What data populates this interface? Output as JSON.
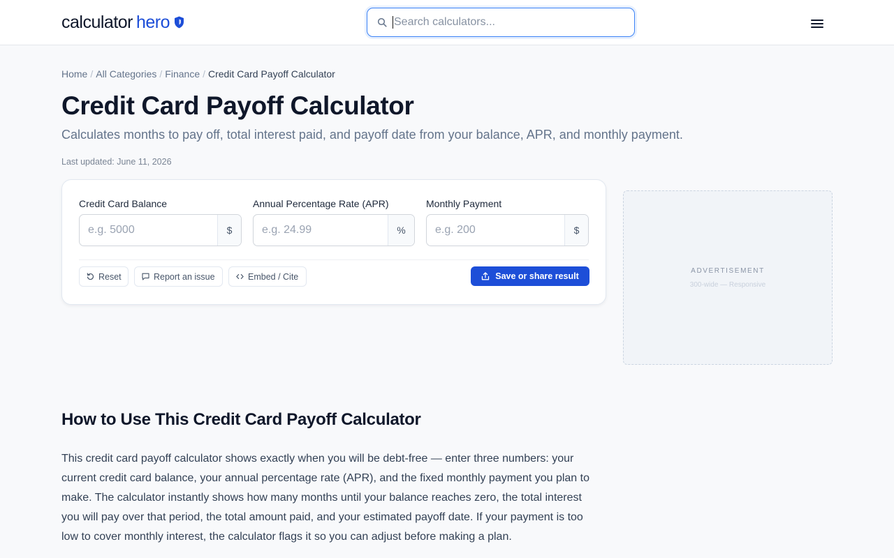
{
  "header": {
    "logo_part1": "calculator",
    "logo_part2": "hero",
    "search_placeholder": "Search calculators...",
    "accent_color": "#1d4ed8"
  },
  "breadcrumb": {
    "items": [
      "Home",
      "All Categories",
      "Finance"
    ],
    "current": "Credit Card Payoff Calculator",
    "separator": "/"
  },
  "page": {
    "title": "Credit Card Payoff Calculator",
    "subtitle": "Calculates months to pay off, total interest paid, and payoff date from your balance, APR, and monthly payment.",
    "updated": "Last updated: June 11, 2026"
  },
  "calculator": {
    "fields": [
      {
        "label": "Credit Card Balance",
        "placeholder": "e.g. 5000",
        "unit": "$",
        "value": ""
      },
      {
        "label": "Annual Percentage Rate (APR)",
        "placeholder": "e.g. 24.99",
        "unit": "%",
        "value": ""
      },
      {
        "label": "Monthly Payment",
        "placeholder": "e.g. 200",
        "unit": "$",
        "value": ""
      }
    ],
    "buttons": {
      "reset": "Reset",
      "report": "Report an issue",
      "embed": "Embed / Cite",
      "save": "Save or share result"
    },
    "icons": {
      "reset": "reset-icon",
      "report": "message-icon",
      "embed": "code-icon",
      "save": "share-icon"
    }
  },
  "ad": {
    "label": "ADVERTISEMENT",
    "size": "300-wide — Responsive"
  },
  "how_to": {
    "heading": "How to Use This Credit Card Payoff Calculator",
    "paragraph": "This credit card payoff calculator shows exactly when you will be debt-free — enter three numbers: your current credit card balance, your annual percentage rate (APR), and the fixed monthly payment you plan to make. The calculator instantly shows how many months until your balance reaches zero, the total interest you will pay over that period, the total amount paid, and your estimated payoff date. If your payment is too low to cover monthly interest, the calculator flags it so you can adjust before making a plan."
  }
}
